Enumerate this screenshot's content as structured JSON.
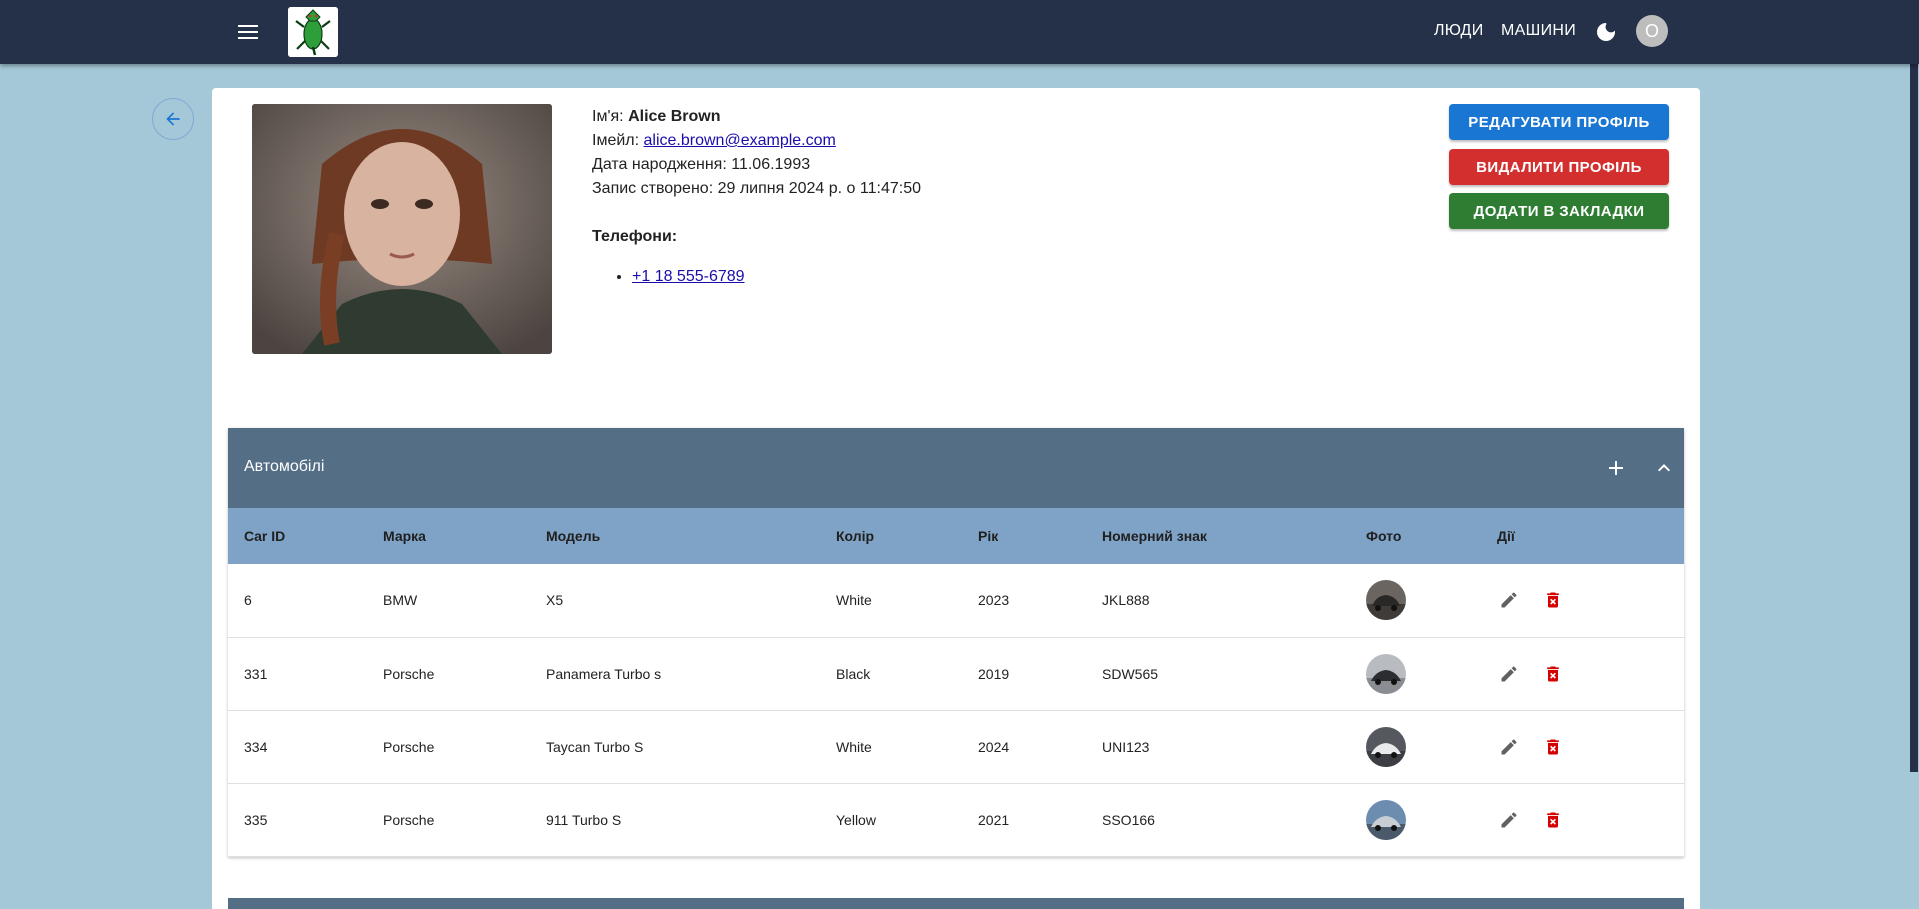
{
  "appbar": {
    "nav": [
      {
        "label": "ЛЮДИ"
      },
      {
        "label": "МАШИНИ"
      }
    ],
    "avatar_letter": "O",
    "icons": {
      "menu": "menu-icon",
      "theme": "moon-icon",
      "logo": "crocodile-logo"
    }
  },
  "profile": {
    "name_label": "Ім'я:",
    "name": "Alice Brown",
    "email_label": "Імейл:",
    "email": "alice.brown@example.com",
    "birth_label": "Дата народження:",
    "birth": "11.06.1993",
    "created_label": "Запис створено:",
    "created": "29 липня 2024 р. о 11:47:50",
    "phones_title": "Телефони:",
    "phones": [
      "+1 18 555-6789"
    ]
  },
  "actions": {
    "edit": "РЕДАГУВАТИ ПРОФІЛЬ",
    "delete": "ВИДАЛИТИ ПРОФІЛЬ",
    "bookmark": "ДОДАТИ В ЗАКЛАДКИ",
    "colors": {
      "edit": "#1976d2",
      "delete": "#d32f2f",
      "bookmark": "#2e7d32"
    }
  },
  "cars": {
    "title": "Автомобілі",
    "columns": [
      "Car ID",
      "Марка",
      "Модель",
      "Колір",
      "Рік",
      "Номерний знак",
      "Фото",
      "Дії"
    ],
    "rows": [
      {
        "id": "6",
        "brand": "BMW",
        "model": "X5",
        "color": "White",
        "year": "2023",
        "plate": "JKL888"
      },
      {
        "id": "331",
        "brand": "Porsche",
        "model": "Panamera Turbo s",
        "color": "Black",
        "year": "2019",
        "plate": "SDW565"
      },
      {
        "id": "334",
        "brand": "Porsche",
        "model": "Taycan Turbo S",
        "color": "White",
        "year": "2024",
        "plate": "UNI123"
      },
      {
        "id": "335",
        "brand": "Porsche",
        "model": "911 Turbo S",
        "color": "Yellow",
        "year": "2021",
        "plate": "SSO166"
      }
    ]
  }
}
